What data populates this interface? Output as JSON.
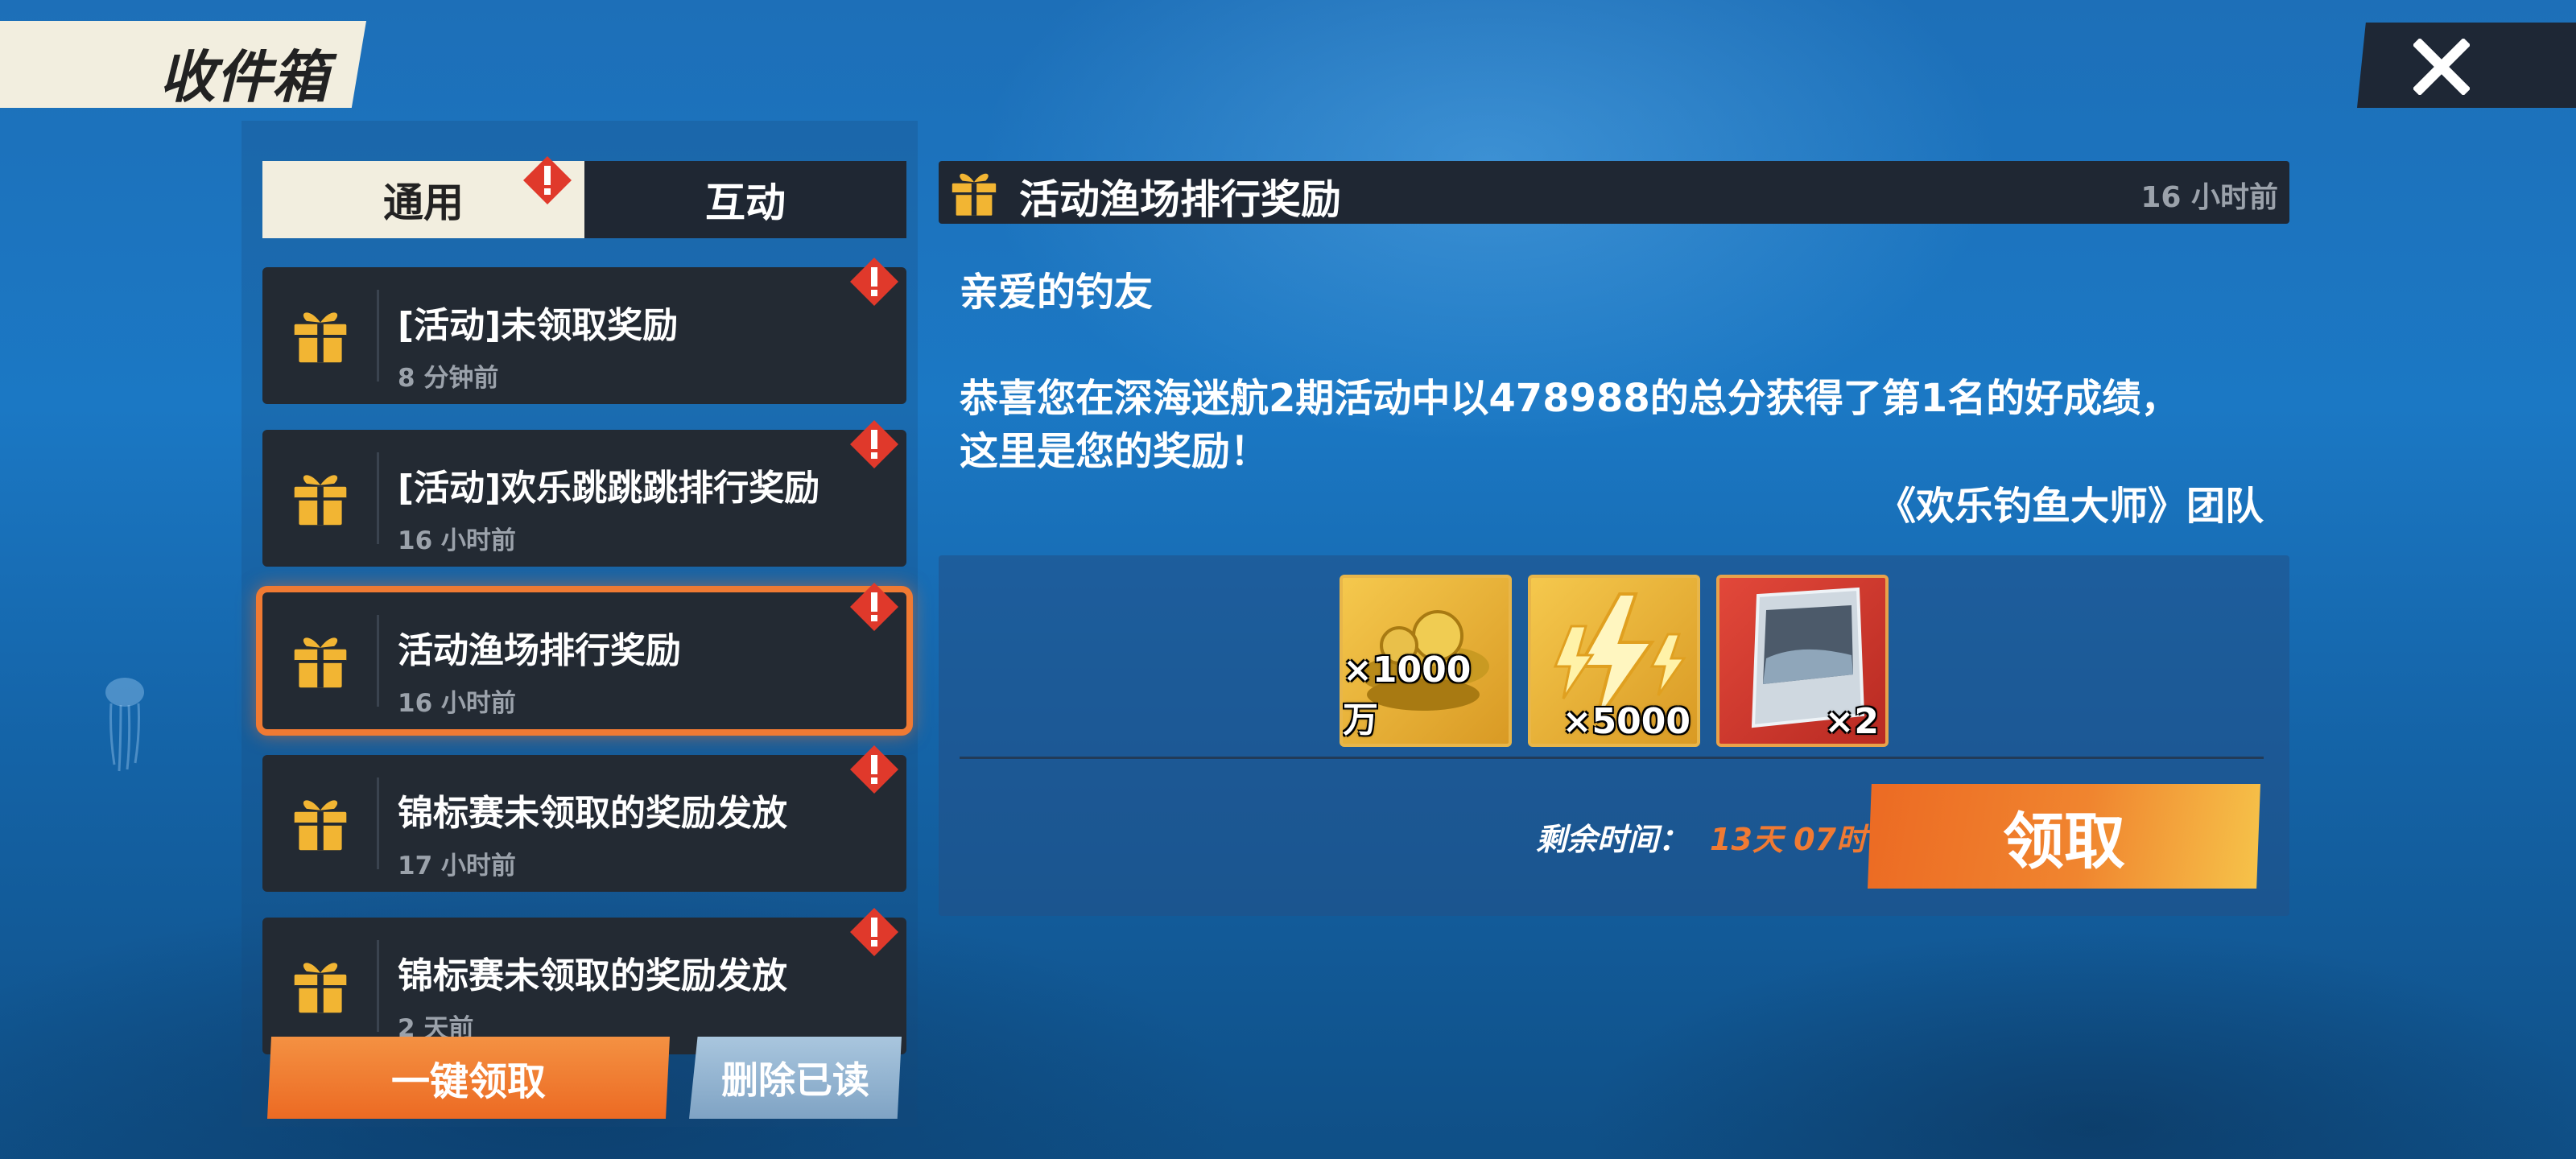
{
  "header": {
    "title": "收件箱"
  },
  "tabs": [
    {
      "label": "通用",
      "active": true,
      "badge": true
    },
    {
      "label": "互动",
      "active": false,
      "badge": false
    }
  ],
  "mail_list": [
    {
      "title": "[活动]未领取奖励",
      "time": "8 分钟前",
      "selected": false
    },
    {
      "title": "[活动]欢乐跳跳跳排行奖励",
      "time": "16 小时前",
      "selected": false
    },
    {
      "title": "活动渔场排行奖励",
      "time": "16 小时前",
      "selected": true
    },
    {
      "title": "锦标赛未领取的奖励发放",
      "time": "17 小时前",
      "selected": false
    },
    {
      "title": "锦标赛未领取的奖励发放",
      "time": "2 天前",
      "selected": false
    }
  ],
  "bottom": {
    "claim_all": "一键领取",
    "delete_read": "删除已读"
  },
  "detail": {
    "title": "活动渔场排行奖励",
    "time": "16 小时前",
    "greeting": "亲爱的钓友",
    "body_line1": "恭喜您在深海迷航2期活动中以478988的总分获得了第1名的好成绩，",
    "body_line2": "这里是您的奖励！",
    "signature": "《欢乐钓鱼大师》团队",
    "rewards": [
      {
        "icon": "gold-coins-icon",
        "qty": "×1000万"
      },
      {
        "icon": "lightning-energy-icon",
        "qty": "×5000"
      },
      {
        "icon": "card-pack-icon",
        "qty": "×2"
      }
    ],
    "remain_label": "剩余时间：",
    "remain_value": "13天 07时",
    "claim": "领取"
  },
  "colors": {
    "accent_orange": "#ec6a23",
    "panel_dark": "#1f2733",
    "tab_light": "#f2eedf",
    "badge_red": "#e0392b"
  }
}
